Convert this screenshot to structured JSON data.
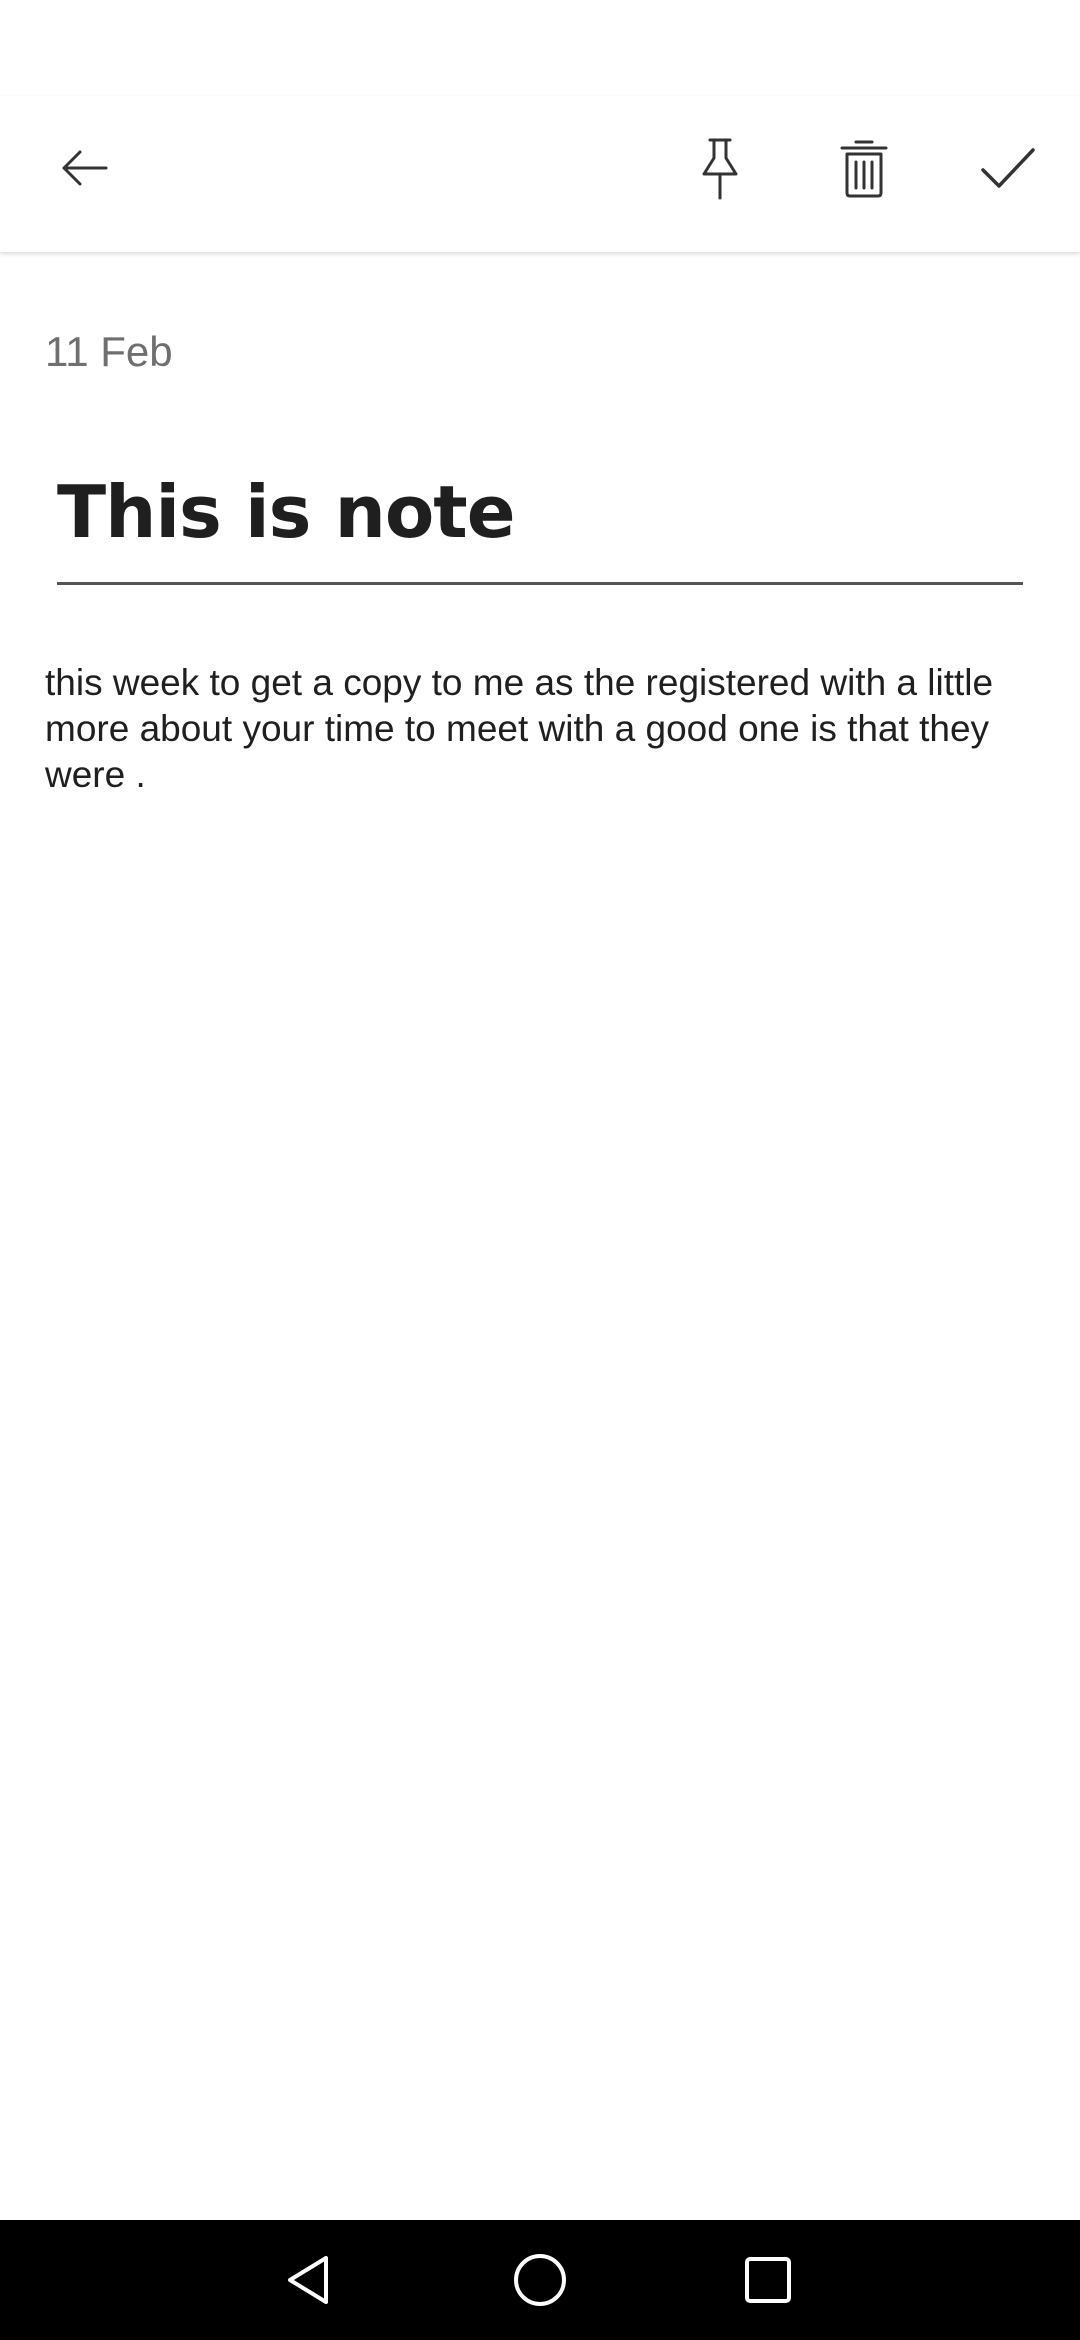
{
  "toolbar": {
    "back_icon": "arrow-left-icon",
    "pin_icon": "pin-icon",
    "delete_icon": "trash-icon",
    "done_icon": "check-icon"
  },
  "note": {
    "date": "11 Feb",
    "title": "This is note",
    "body": "this week to get a copy to me as the registered with a little more about your time to meet with a good one is that they were ."
  },
  "navigation": {
    "back_icon": "nav-back-triangle-icon",
    "home_icon": "nav-home-circle-icon",
    "recents_icon": "nav-recents-square-icon"
  },
  "colors": {
    "background": "#ffffff",
    "text": "#1f1f1f",
    "date_text": "#6f6f6f",
    "nav_bar": "#000000"
  }
}
